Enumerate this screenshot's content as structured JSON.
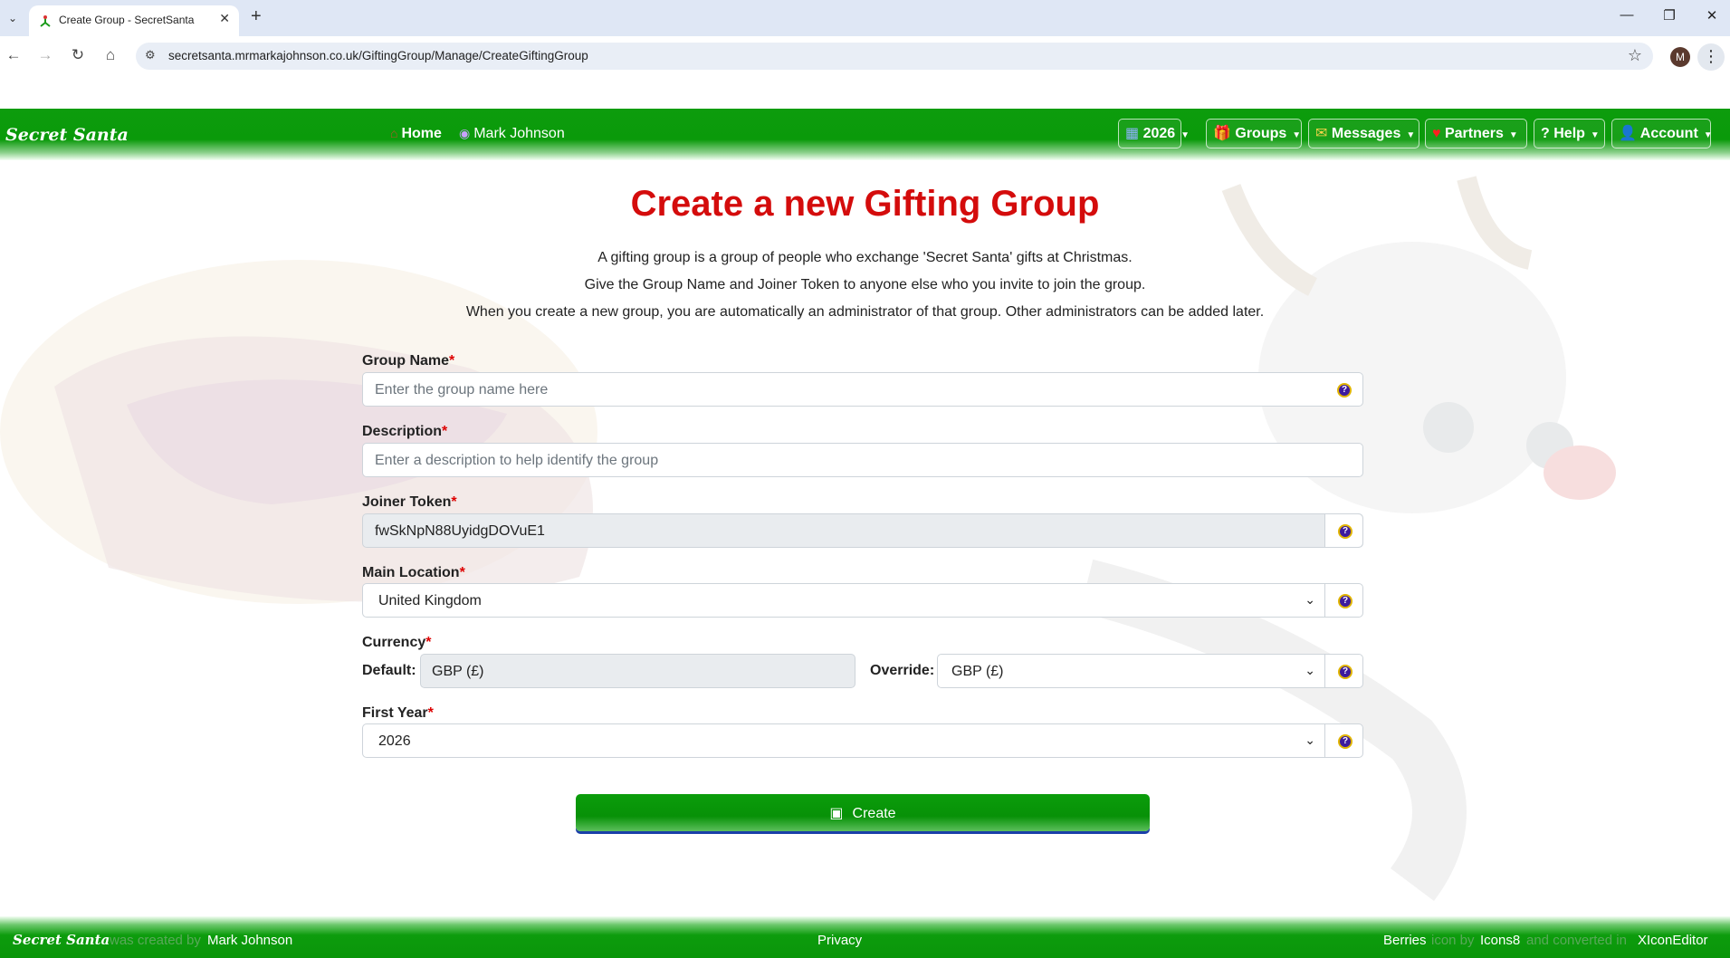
{
  "browser": {
    "tab_title": "Create Group - SecretSanta",
    "url": "secretsanta.mrmarkajohnson.co.uk/GiftingGroup/Manage/CreateGiftingGroup",
    "profile_initial": "M"
  },
  "navbar": {
    "brand": "Secret Santa",
    "home_label": "Home",
    "user_label": "Mark Johnson",
    "year_label": "2026",
    "groups_label": "Groups",
    "messages_label": "Messages",
    "partners_label": "Partners",
    "help_label": "Help",
    "account_label": "Account"
  },
  "page": {
    "title": "Create a new Gifting Group",
    "intro_1": "A gifting group is a group of people who exchange 'Secret Santa' gifts at Christmas.",
    "intro_2": "Give the Group Name and Joiner Token to anyone else who you invite to join the group.",
    "intro_3": "When you create a new group, you are automatically an administrator of that group. Other administrators can be added later."
  },
  "form": {
    "group_name_label": "Group Name",
    "group_name_placeholder": "Enter the group name here",
    "description_label": "Description",
    "description_placeholder": "Enter a description to help identify the group",
    "joiner_token_label": "Joiner Token",
    "joiner_token_value": "fwSkNpN88UyidgDOVuE1",
    "main_location_label": "Main Location",
    "main_location_value": "United Kingdom",
    "currency_label": "Currency",
    "currency_default_label": "Default:",
    "currency_default_value": "GBP (£)",
    "currency_override_label": "Override:",
    "currency_override_value": "GBP (£)",
    "first_year_label": "First Year",
    "first_year_value": "2026",
    "required_mark": "*",
    "create_label": "Create"
  },
  "footer": {
    "brand": "Secret Santa",
    "created_by": "was created by",
    "author": "Mark Johnson",
    "privacy": "Privacy",
    "berries": "Berries",
    "icon_by": "icon by",
    "icons8": "Icons8",
    "converted_in": "and converted in",
    "xicon": "XIconEditor"
  },
  "colors": {
    "nav_green": "#0d9c0d",
    "title_red": "#d40c0c",
    "help_purple": "#3d1a9e"
  }
}
